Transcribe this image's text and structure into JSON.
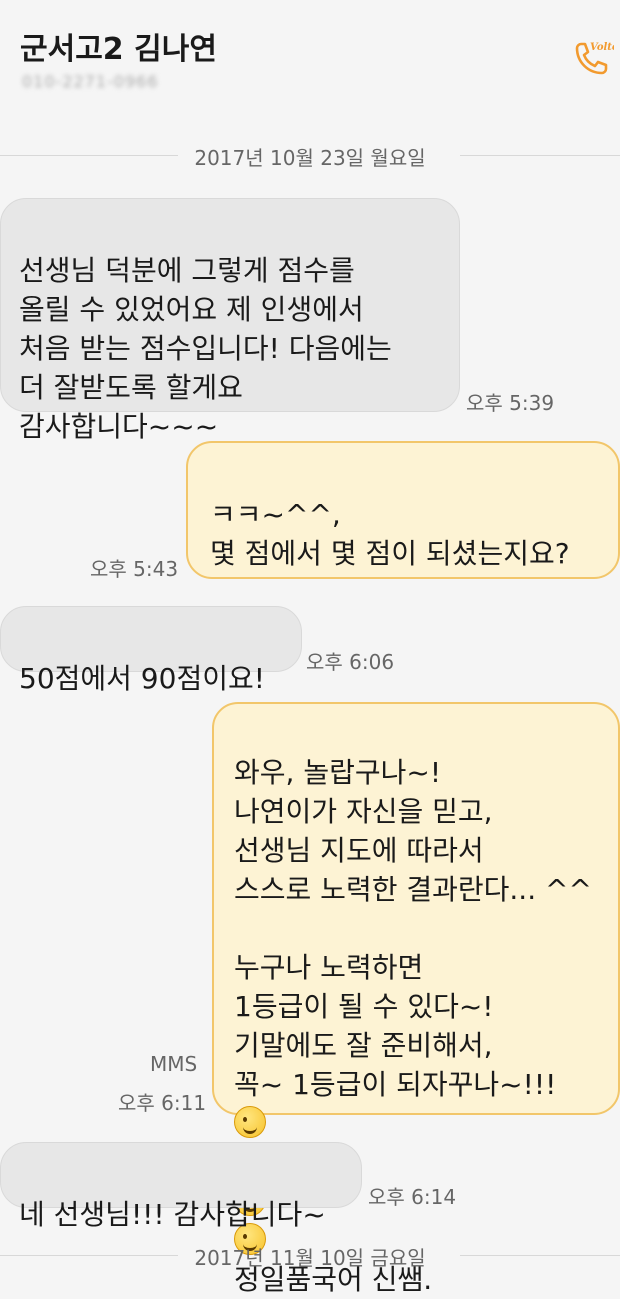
{
  "header": {
    "contact_name": "군서고2 김나연",
    "contact_number": "010-2271-0966",
    "call_icon_label": "Volte"
  },
  "dates": [
    "2017년 10월 23일 월요일",
    "2017년 11월 10일 금요일"
  ],
  "messages": [
    {
      "dir": "in",
      "text": "선생님 덕분에 그렇게 점수를\n올릴 수 있었어요 제 인생에서\n처음 받는 점수입니다! 다음에는\n더 잘받도록 할게요\n감사합니다~~~",
      "time": "오후 5:39"
    },
    {
      "dir": "out",
      "text": "ㅋㅋ~^^,\n몇 점에서 몇 점이 되셨는지요?",
      "time": "오후 5:43"
    },
    {
      "dir": "in",
      "text": "50점에서 90점이요!",
      "time": "오후 6:06"
    },
    {
      "dir": "out",
      "text": "와우, 놀랍구나~!\n나연이가 자신을 믿고,\n선생님 지도에 따라서\n스스로 노력한 결과란다... ^^\n\n누구나 노력하면\n1등급이 될 수 있다~!\n기말에도 잘 준비해서,\n꼭~ 1등급이 되자꾸나~!!!",
      "tail": "정일품국어 신쌤.",
      "type": "MMS",
      "time": "오후 6:11"
    },
    {
      "dir": "in",
      "text": "네 선생님!!! 감사합니다~",
      "time": "오후 6:14"
    }
  ],
  "colors": {
    "incoming_bubble": "#e7e7e7",
    "outgoing_bubble": "#fdf3d4",
    "outgoing_border": "#f2c66a",
    "accent": "#f29a2e"
  }
}
